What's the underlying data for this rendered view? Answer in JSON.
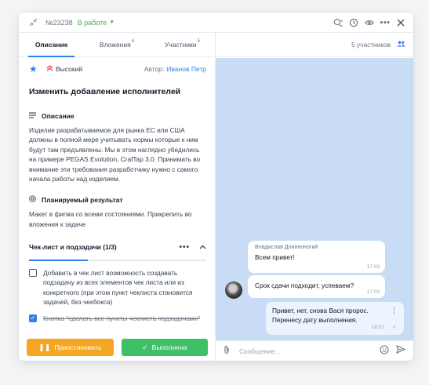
{
  "header": {
    "task_id": "№23238",
    "status": "В работе"
  },
  "tabs": [
    {
      "label": "Описание",
      "count": ""
    },
    {
      "label": "Вложения",
      "count": "4"
    },
    {
      "label": "Участники",
      "count": "5"
    }
  ],
  "task": {
    "priority": "Высокий",
    "author_label": "Автор:",
    "author_name": "Иванов Петр",
    "title": "Изменить добавление исполнителей",
    "description_heading": "Описание",
    "description": "Изделие разрабатываемое для рынка ЕС или США должны в полной мере учитывать нормы которые к ним будут там предъявлены. Мы в этом наглядно убедились на примере PEGAS Evolution, CrafTap 3.0. Принимать во внимание эти требования разработчику нужно с самого начала работы над изделием.",
    "result_heading": "Планируемый результат",
    "result": "Макет в фигма со всеми состояниями. Прикрепить во вложения к задаче"
  },
  "checklist": {
    "title": "Чек-лист и подзадачи (1/3)",
    "progress": 0.33,
    "items": [
      {
        "text": "Добавить в чек лист возможность создавать подзадачу из всех элементов чек листа или из конкретного (при этом пункт чеклиста становится задачей, без чекбокса)",
        "checked": false
      },
      {
        "text": "Кнопка \"сделать все пункты чеклиста подзадачами\" (возможно три точки в заголовке чеклиста, выбираем чекбоксами, какие пункты хотим сделать подзадачами)",
        "checked": true
      }
    ]
  },
  "actions": {
    "pause": "Приостановить",
    "done": "Выполнена"
  },
  "chat": {
    "participants": "5 участников",
    "messages": [
      {
        "sender": "Владислав Длинноногий",
        "text": "Всем привет!",
        "time": "17:03"
      },
      {
        "text": "Срок сдачи подходит, успеваем?",
        "time": "17:03"
      },
      {
        "text": "Привет, нет, снова Вася пророс. Перенесу дату выполнения.",
        "time": "18:01"
      }
    ],
    "composer_placeholder": "Сообщение..."
  },
  "colors": {
    "accent": "#2f80ed",
    "status": "#4caf50",
    "pause": "#f5a623",
    "done": "#3fbf68",
    "chat_bg": "#c9dcf6"
  }
}
